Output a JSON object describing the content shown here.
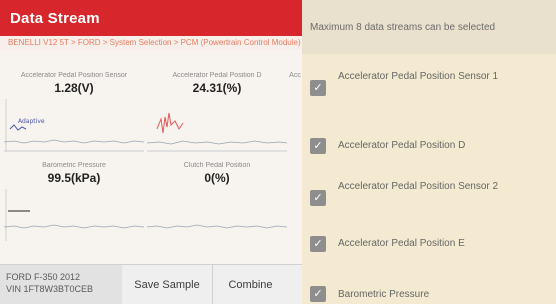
{
  "header": {
    "title": "Data Stream"
  },
  "breadcrumb": "BENELLI V12 5T > FORD > System Selection > PCM (Powertrain Control Module)",
  "cells": [
    {
      "label": "Accelerator Pedal Position Sensor",
      "value": "1.28(V)",
      "legend": "Adaptive"
    },
    {
      "label": "Accelerator Pedal Position D",
      "value": "24.31(%)"
    },
    {
      "label": "Acc"
    },
    {
      "label": "Barometric Pressure",
      "value": "99.5(kPa)"
    },
    {
      "label": "Clutch Pedal Position",
      "value": "0(%)"
    }
  ],
  "bottom": {
    "vehicle_line1": "FORD F-350 2012",
    "vehicle_line2": "VIN 1FT8W3BT0CEB",
    "save_label": "Save Sample",
    "combine_label": "Combine"
  },
  "overlay": {
    "header": "Maximum 8 data streams can be selected",
    "items": [
      {
        "label": "Accelerator Pedal Position Sensor 1",
        "checked": true
      },
      {
        "label": "Accelerator Pedal Position D",
        "checked": true
      },
      {
        "label": "Accelerator Pedal Position Sensor 2",
        "checked": true
      },
      {
        "label": "Accelerator Pedal Position E",
        "checked": true
      },
      {
        "label": "Barometric Pressure",
        "checked": true
      }
    ]
  }
}
